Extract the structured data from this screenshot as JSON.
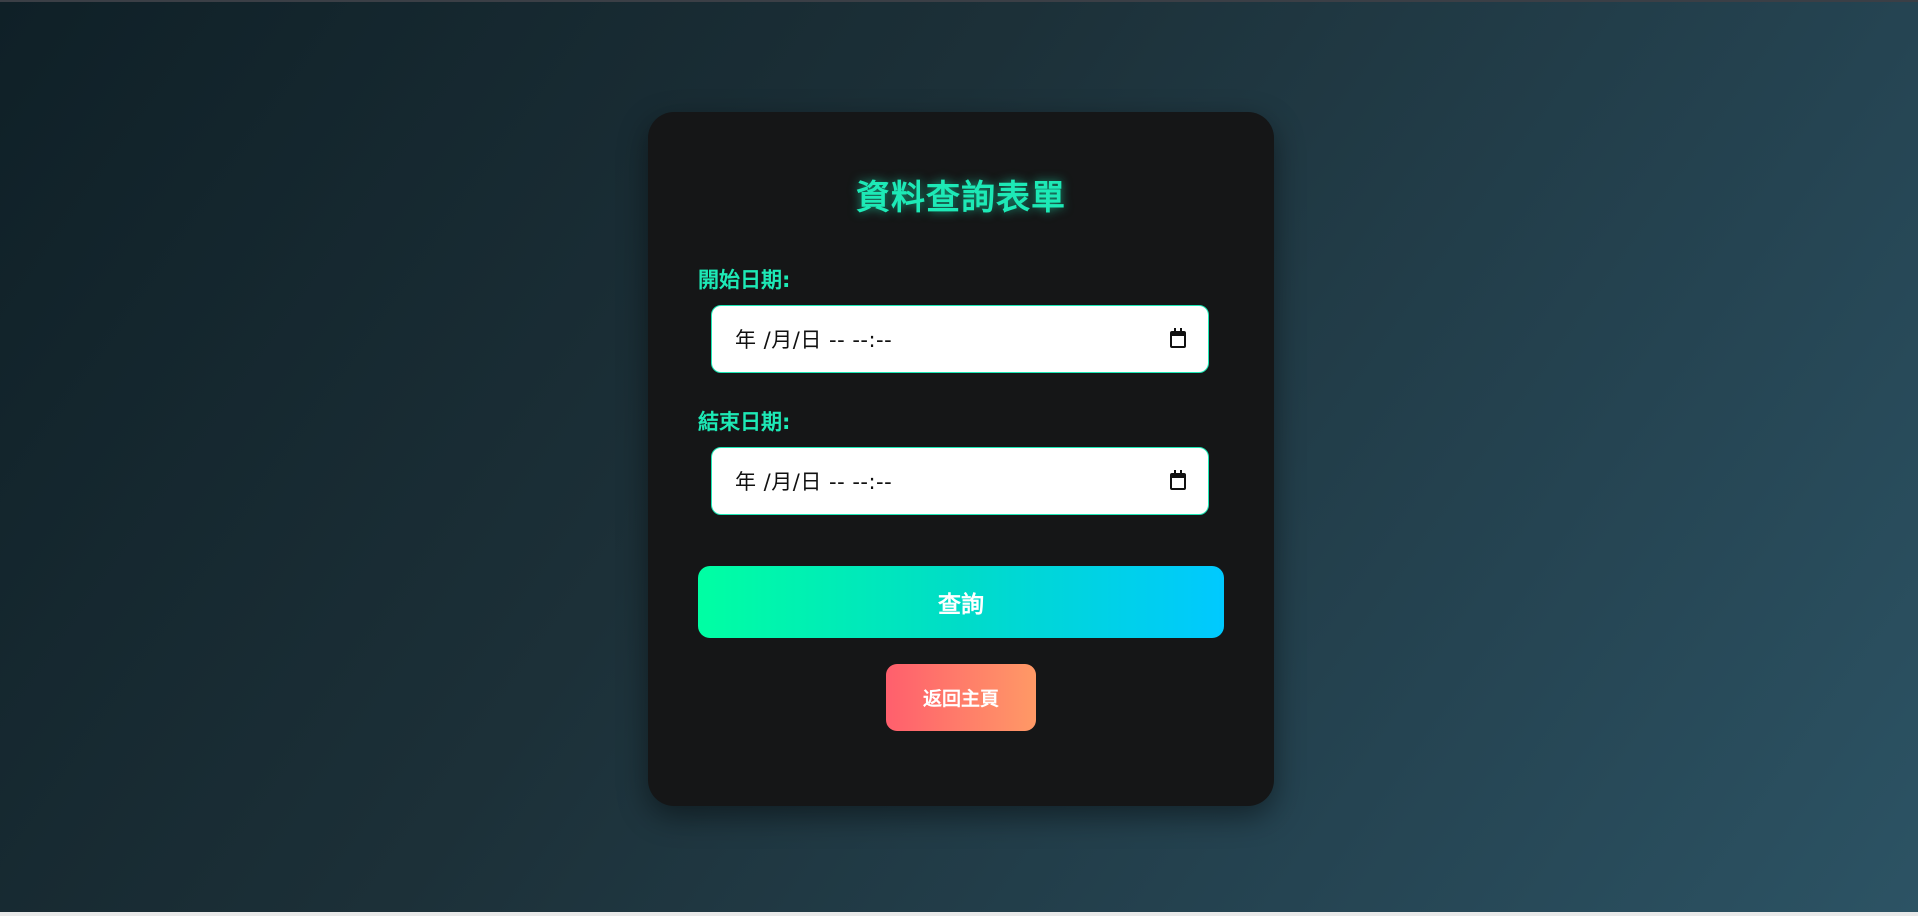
{
  "form": {
    "title": "資料查詢表單",
    "start_label": "開始日期:",
    "start_value": "年 /月/日 -- --:--",
    "end_label": "結束日期:",
    "end_value": "年 /月/日 -- --:--",
    "query_label": "查詢",
    "home_label": "返回主頁"
  },
  "colors": {
    "accent": "#1de9b6",
    "card_background": "#151617",
    "query_gradient": [
      "#00ffa3",
      "#00c9ff"
    ],
    "home_gradient": [
      "#ff5f6d",
      "#ff9966"
    ]
  },
  "icons": {
    "date_picker": "calendar-icon"
  }
}
